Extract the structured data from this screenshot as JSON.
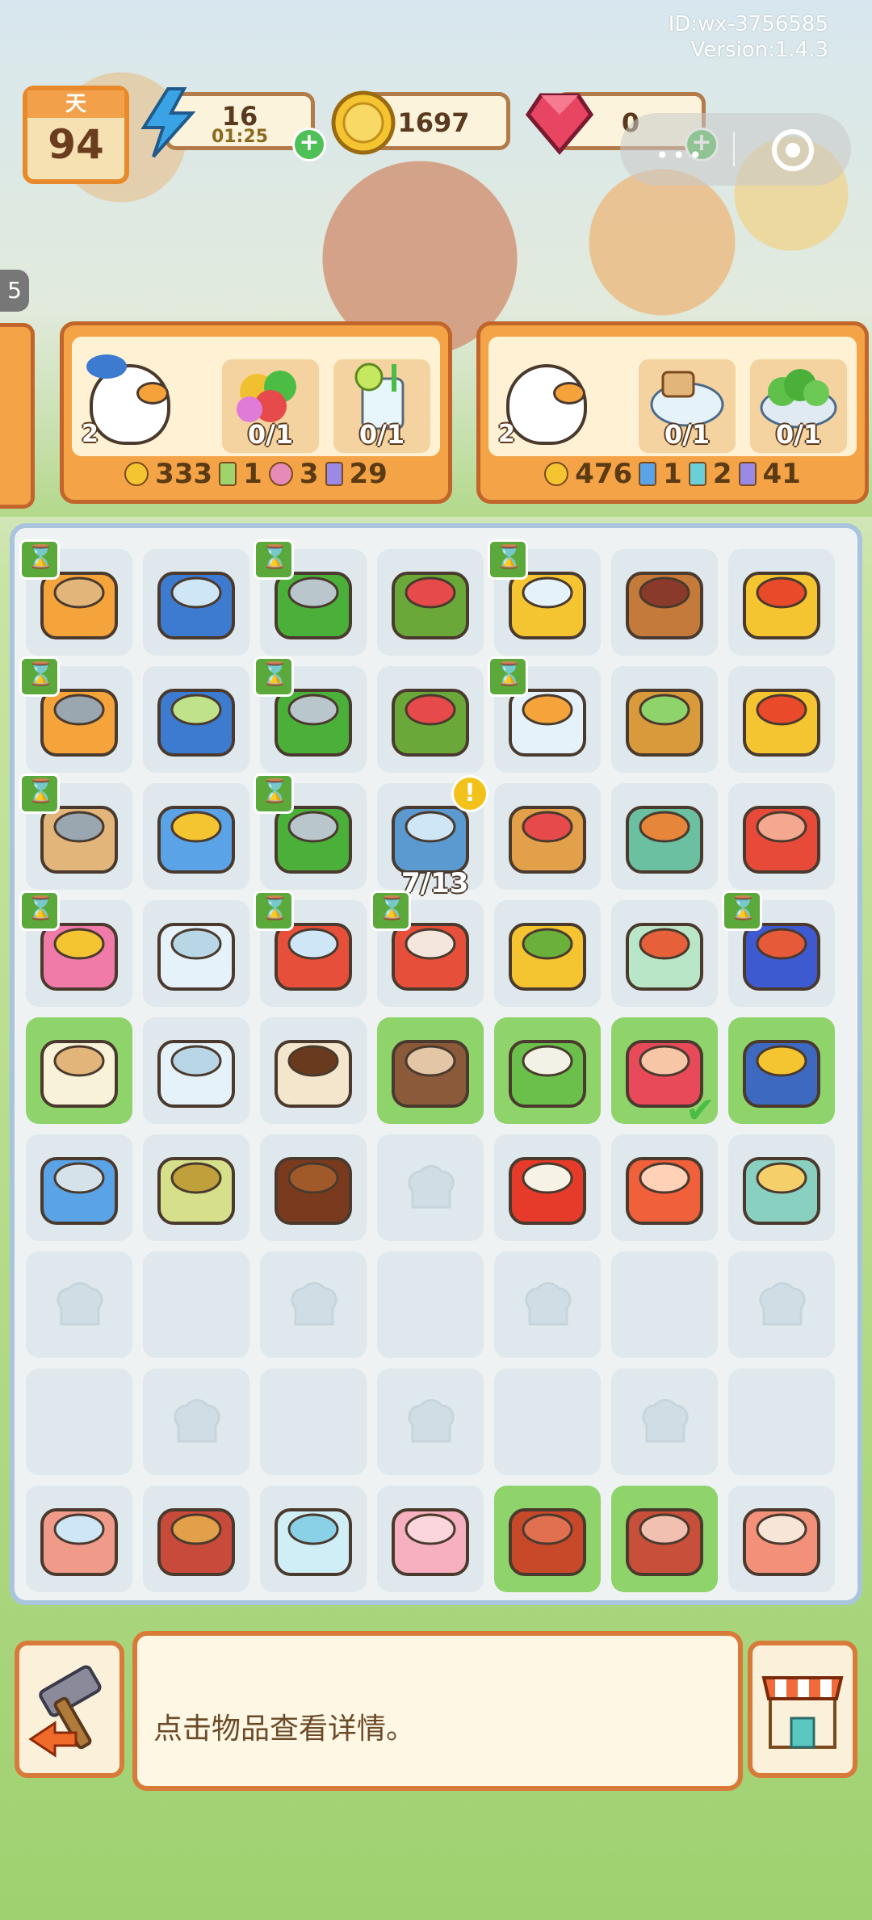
{
  "meta": {
    "id_text": "ID:wx-3756585",
    "version_text": "Version:1.4.3"
  },
  "topbar": {
    "day_label": "天",
    "day_value": "94",
    "energy": {
      "value": "16",
      "timer": "01:25"
    },
    "coins": {
      "value": "1697"
    },
    "gems": {
      "value": "0"
    }
  },
  "side_tab_label": "5",
  "orders": [
    {
      "hearts": "2",
      "slots": [
        {
          "icon": "gummy-candy",
          "count": "0/1"
        },
        {
          "icon": "lemon-drink",
          "count": "0/1"
        }
      ],
      "reward": {
        "coins": "333",
        "cards": "1",
        "flowers": "3",
        "potions": "29"
      }
    },
    {
      "hearts": "2",
      "slots": [
        {
          "icon": "bread-yogurt",
          "count": "0/1"
        },
        {
          "icon": "broccoli-bowl",
          "count": "0/1"
        }
      ],
      "reward": {
        "coins": "476",
        "cards": "1",
        "lotion": "2",
        "potions": "41"
      }
    }
  ],
  "board": {
    "generator_progress": "7/13",
    "rows": [
      [
        "cutting-board-cabinet",
        "fridge",
        "stove",
        "fruit-basket",
        "blender",
        "spice-rack",
        "gold-bow-bag"
      ],
      [
        "knife-cabinet",
        "fridge-open",
        "stove",
        "vegetable-bowl",
        "juicer",
        "lettuce-basket",
        "gold-bow-bag"
      ],
      [
        "cutting-board",
        "ice-box",
        "stove",
        "toaster",
        "vegetable-crate",
        "storage-box",
        "fishing-reel"
      ],
      [
        "microwave",
        "glass-cup",
        "pot",
        "roasting-pan",
        "corn",
        "pickle-jar",
        "oven"
      ],
      [
        "milk-bottle",
        "glass-bowl",
        "coffee-cup",
        "mushrooms",
        "scallions",
        "red-tea",
        "tuna"
      ],
      [
        "tin-can",
        "tea-bag",
        "coffee-beans",
        "empty",
        "chili-plate",
        "red-fish",
        "clam"
      ],
      [
        "empty",
        "blank",
        "empty",
        "blank",
        "empty",
        "blank",
        "empty"
      ],
      [
        "blank",
        "empty",
        "blank",
        "empty",
        "blank",
        "empty",
        "blank"
      ],
      [
        "meat-case",
        "steak-board",
        "ice-cubes",
        "raw-chicken",
        "meatballs",
        "bacon",
        "ham"
      ]
    ]
  },
  "info": {
    "text": "点击物品查看详情。"
  }
}
